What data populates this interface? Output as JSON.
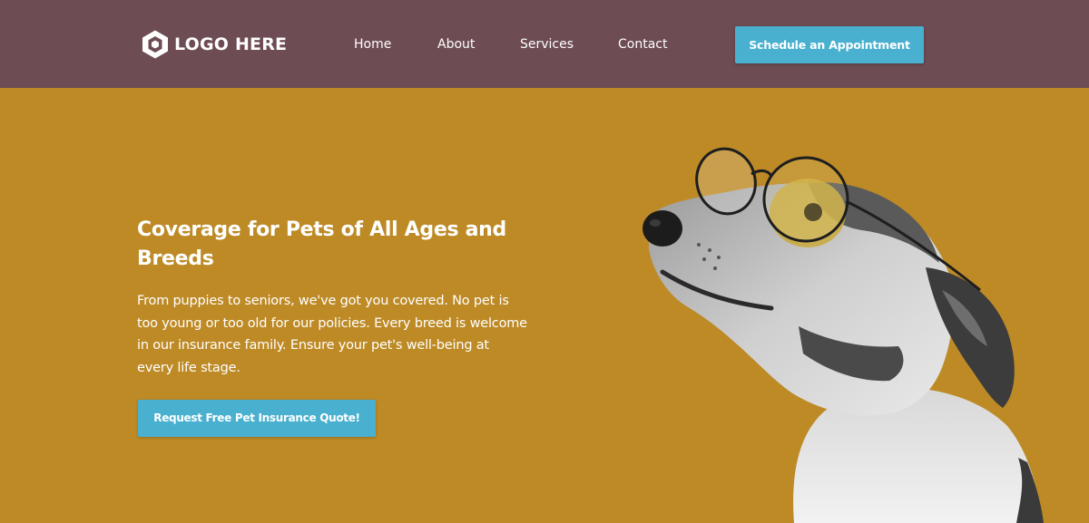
{
  "header": {
    "logo_text": "LOGO HERE",
    "nav": {
      "home": "Home",
      "about": "About",
      "services": "Services",
      "contact": "Contact"
    },
    "cta_label": "Schedule an Appointment"
  },
  "hero": {
    "title": "Coverage for Pets of All Ages and Breeds",
    "description": "From puppies to seniors, we've got you covered. No pet is too young or too old for our policies. Every breed is welcome in our insurance family. Ensure your pet's well-being at every life stage.",
    "cta_label": "Request Free Pet Insurance Quote!"
  },
  "colors": {
    "header_bg": "#6d4c53",
    "hero_bg": "#bd8a26",
    "accent": "#49b0cf",
    "text": "#ffffff"
  },
  "icons": {
    "logo": "hexagon-logo-icon",
    "hero_image": "dog-with-glasses-image"
  }
}
